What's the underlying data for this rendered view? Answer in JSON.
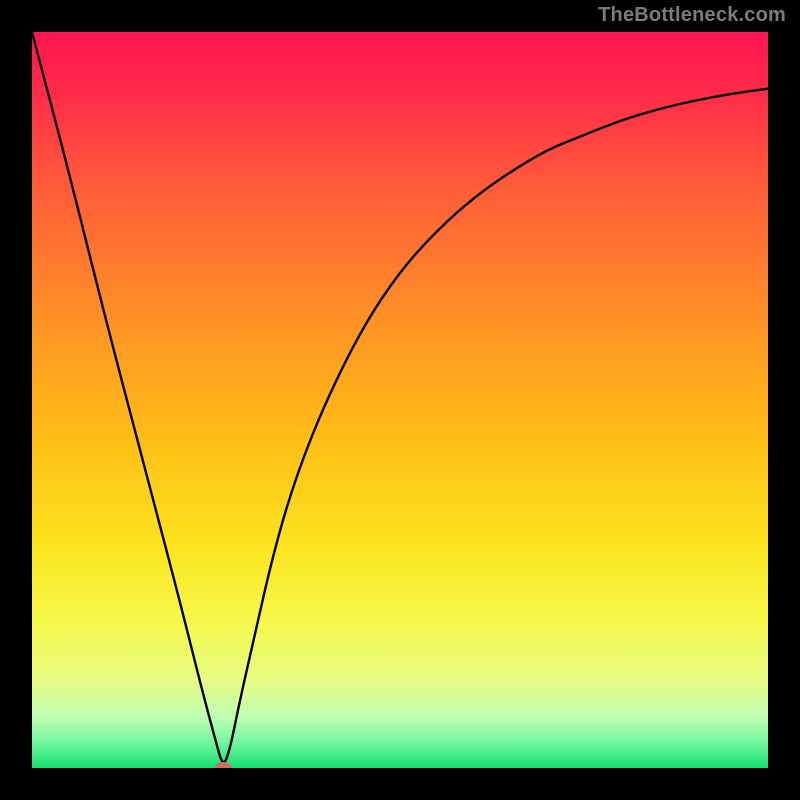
{
  "attribution": "TheBottleneck.com",
  "chart_data": {
    "type": "line",
    "title": "",
    "xlabel": "",
    "ylabel": "",
    "xlim": [
      0,
      100
    ],
    "ylim": [
      0,
      100
    ],
    "grid": false,
    "legend": false,
    "x": [
      0,
      5,
      10,
      15,
      20,
      23,
      25,
      26,
      27,
      28,
      30,
      33,
      36,
      40,
      45,
      50,
      55,
      60,
      65,
      70,
      75,
      80,
      85,
      90,
      95,
      100
    ],
    "series": [
      {
        "name": "bottleneck-curve",
        "color": "#000000",
        "values": [
          100,
          81,
          61,
          42,
          23,
          11,
          3.5,
          0,
          3,
          8,
          17,
          30,
          40,
          50,
          60,
          67.5,
          73,
          77.5,
          81,
          84,
          86,
          88,
          89.5,
          90.7,
          91.6,
          92.3
        ]
      }
    ],
    "annotations": [
      {
        "type": "marker",
        "x": 26,
        "y": 0,
        "label": "min-marker",
        "color": "#d06a6a"
      }
    ],
    "background_gradient": {
      "type": "vertical",
      "stops": [
        {
          "pos": 0.0,
          "color": "#ff1552"
        },
        {
          "pos": 0.08,
          "color": "#ff2a49"
        },
        {
          "pos": 0.22,
          "color": "#ff5f38"
        },
        {
          "pos": 0.4,
          "color": "#ff9425"
        },
        {
          "pos": 0.55,
          "color": "#ffbd16"
        },
        {
          "pos": 0.7,
          "color": "#fbe41f"
        },
        {
          "pos": 0.8,
          "color": "#f6f84a"
        },
        {
          "pos": 0.88,
          "color": "#e7fc84"
        },
        {
          "pos": 0.93,
          "color": "#c0feb1"
        },
        {
          "pos": 0.965,
          "color": "#73f6a0"
        },
        {
          "pos": 1.0,
          "color": "#15e06f"
        }
      ]
    }
  }
}
